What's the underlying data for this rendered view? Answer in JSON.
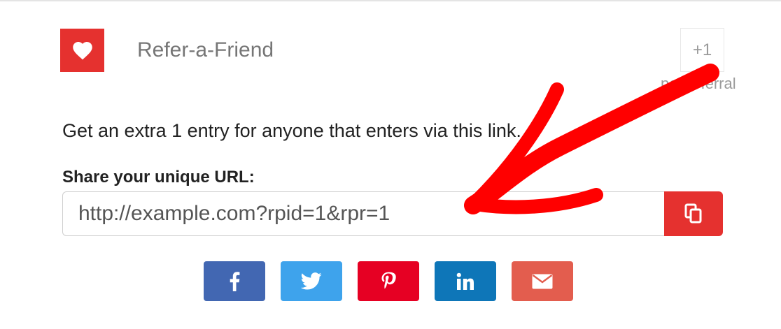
{
  "entry": {
    "title": "Refer-a-Friend",
    "points": "+1",
    "points_label": "per referral",
    "description": "Get an extra 1 entry for anyone that enters via this link.",
    "share_label": "Share your unique URL:",
    "url_value": "http://example.com?rpid=1&rpr=1"
  },
  "share_buttons": [
    {
      "network": "facebook",
      "icon": "facebook-icon",
      "color": "#4267b2"
    },
    {
      "network": "twitter",
      "icon": "twitter-icon",
      "color": "#3ea3ec"
    },
    {
      "network": "pinterest",
      "icon": "pinterest-icon",
      "color": "#e60023"
    },
    {
      "network": "linkedin",
      "icon": "linkedin-icon",
      "color": "#0e76b8"
    },
    {
      "network": "email",
      "icon": "envelope-icon",
      "color": "#e35d4e"
    }
  ],
  "colors": {
    "accent": "#e5312f",
    "annotation_arrow": "#ff0000"
  }
}
